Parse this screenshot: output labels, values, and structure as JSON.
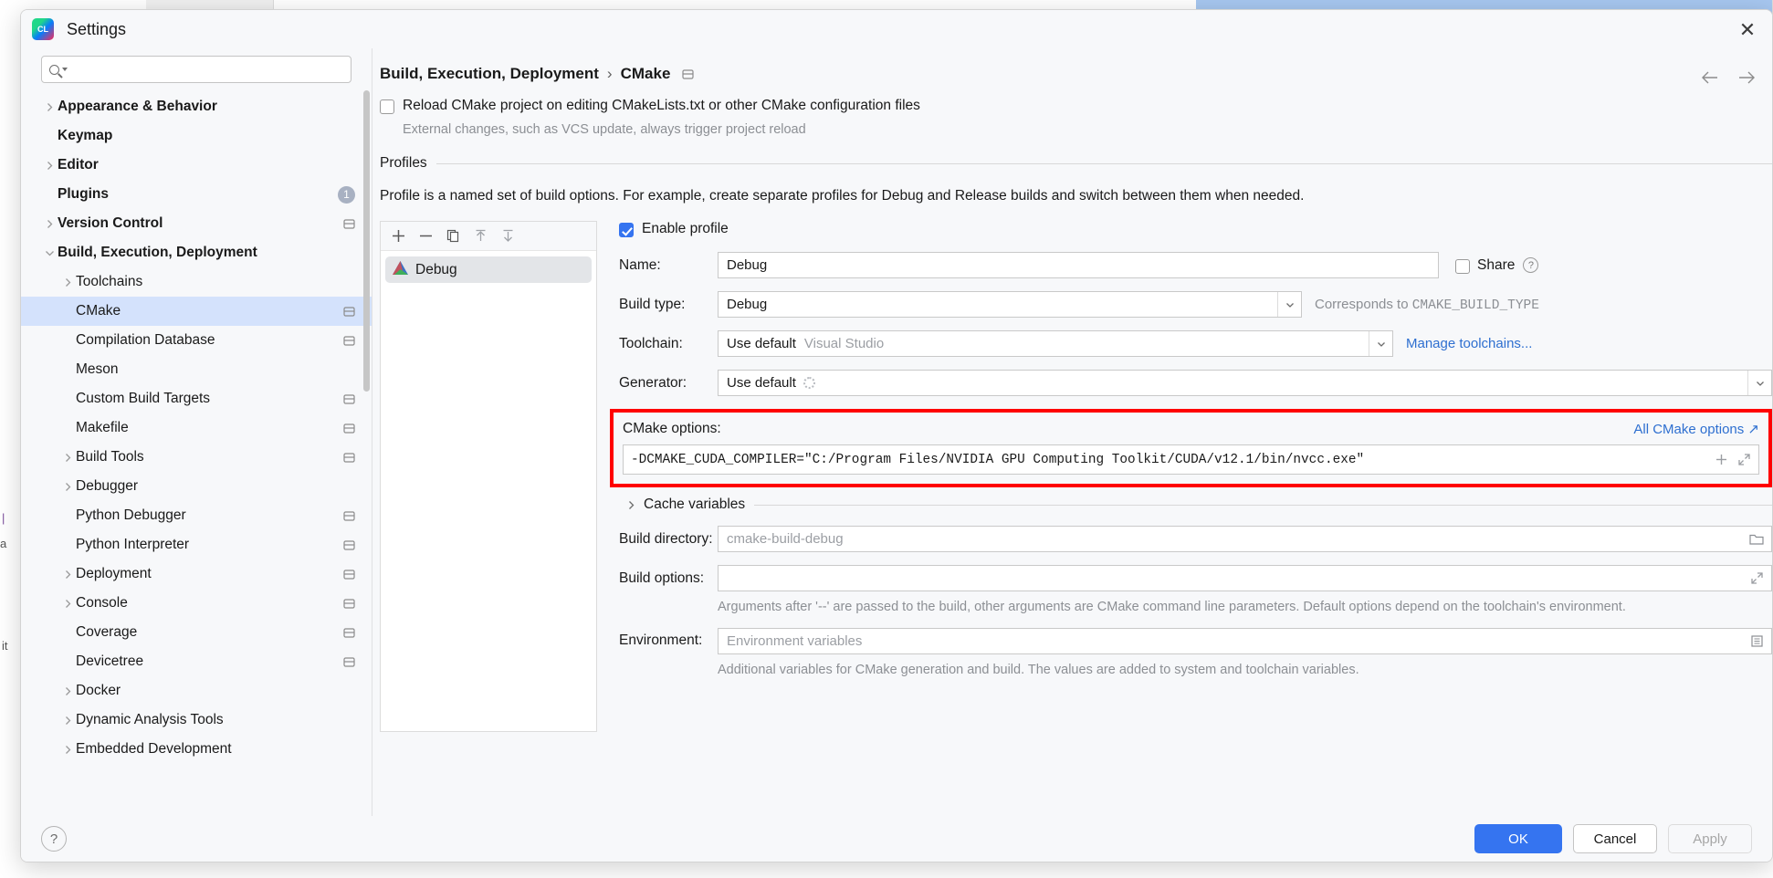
{
  "window": {
    "title": "Settings",
    "app_icon": "clion-icon",
    "close_icon": "close-icon"
  },
  "search": {
    "value": "",
    "placeholder": "",
    "icon": "search-icon"
  },
  "sidebar": {
    "items": [
      {
        "label": "Appearance & Behavior",
        "level": 0,
        "twisty": "chevron-right",
        "selected": false
      },
      {
        "label": "Keymap",
        "level": 0,
        "twisty": "none",
        "selected": false
      },
      {
        "label": "Editor",
        "level": 0,
        "twisty": "chevron-right",
        "selected": false
      },
      {
        "label": "Plugins",
        "level": 0,
        "twisty": "none",
        "selected": false,
        "badge": "1"
      },
      {
        "label": "Version Control",
        "level": 0,
        "twisty": "chevron-right",
        "selected": false,
        "project_icon": true
      },
      {
        "label": "Build, Execution, Deployment",
        "level": 0,
        "twisty": "chevron-down",
        "selected": false
      },
      {
        "label": "Toolchains",
        "level": 1,
        "twisty": "chevron-right",
        "selected": false
      },
      {
        "label": "CMake",
        "level": 1,
        "twisty": "none",
        "selected": true,
        "project_icon": true
      },
      {
        "label": "Compilation Database",
        "level": 1,
        "twisty": "none",
        "selected": false,
        "project_icon": true
      },
      {
        "label": "Meson",
        "level": 1,
        "twisty": "none",
        "selected": false
      },
      {
        "label": "Custom Build Targets",
        "level": 1,
        "twisty": "none",
        "selected": false,
        "project_icon": true
      },
      {
        "label": "Makefile",
        "level": 1,
        "twisty": "none",
        "selected": false,
        "project_icon": true
      },
      {
        "label": "Build Tools",
        "level": 1,
        "twisty": "chevron-right",
        "selected": false,
        "project_icon": true
      },
      {
        "label": "Debugger",
        "level": 1,
        "twisty": "chevron-right",
        "selected": false
      },
      {
        "label": "Python Debugger",
        "level": 1,
        "twisty": "none",
        "selected": false,
        "project_icon": true
      },
      {
        "label": "Python Interpreter",
        "level": 1,
        "twisty": "none",
        "selected": false,
        "project_icon": true
      },
      {
        "label": "Deployment",
        "level": 1,
        "twisty": "chevron-right",
        "selected": false,
        "project_icon": true
      },
      {
        "label": "Console",
        "level": 1,
        "twisty": "chevron-right",
        "selected": false,
        "project_icon": true
      },
      {
        "label": "Coverage",
        "level": 1,
        "twisty": "none",
        "selected": false,
        "project_icon": true
      },
      {
        "label": "Devicetree",
        "level": 1,
        "twisty": "none",
        "selected": false,
        "project_icon": true
      },
      {
        "label": "Docker",
        "level": 1,
        "twisty": "chevron-right",
        "selected": false
      },
      {
        "label": "Dynamic Analysis Tools",
        "level": 1,
        "twisty": "chevron-right",
        "selected": false
      },
      {
        "label": "Embedded Development",
        "level": 1,
        "twisty": "chevron-right",
        "selected": false
      }
    ]
  },
  "breadcrumb": {
    "root": "Build, Execution, Deployment",
    "separator": "›",
    "leaf": "CMake",
    "project_icon": "project-scope-icon",
    "back_icon": "arrow-left-icon",
    "forward_icon": "arrow-right-icon"
  },
  "main": {
    "reload_checkbox": {
      "label": "Reload CMake project on editing CMakeLists.txt or other CMake configuration files",
      "checked": false
    },
    "reload_hint": "External changes, such as VCS update, always trigger project reload",
    "profiles_group_title": "Profiles",
    "profiles_description": "Profile is a named set of build options. For example, create separate profiles for Debug and Release builds and switch between them when needed.",
    "profile_toolbar": [
      {
        "name": "add-profile-button",
        "glyph": "+"
      },
      {
        "name": "remove-profile-button",
        "glyph": "−"
      },
      {
        "name": "copy-profile-button",
        "glyph": "copy-icon"
      },
      {
        "name": "move-up-button",
        "glyph": "arrow-up-icon"
      },
      {
        "name": "move-down-button",
        "glyph": "arrow-down-icon"
      }
    ],
    "profiles": [
      {
        "name": "Debug",
        "selected": true,
        "icon": "cmake-icon"
      }
    ],
    "form": {
      "enable_profile": {
        "label": "Enable profile",
        "checked": true
      },
      "name": {
        "label": "Name:",
        "value": "Debug"
      },
      "share": {
        "label": "Share",
        "checked": false,
        "help_icon": "help-icon"
      },
      "build_type": {
        "label": "Build type:",
        "value": "Debug",
        "note_prefix": "Corresponds to ",
        "note_mono": "CMAKE_BUILD_TYPE"
      },
      "toolchain": {
        "label": "Toolchain:",
        "value": "Use default",
        "value_muted": "Visual Studio",
        "link": "Manage toolchains..."
      },
      "generator": {
        "label": "Generator:",
        "value": "Use default",
        "loading": true
      },
      "cmake_options": {
        "label": "CMake options:",
        "value": "-DCMAKE_CUDA_COMPILER=\"C:/Program Files/NVIDIA GPU Computing Toolkit/CUDA/v12.1/bin/nvcc.exe\"",
        "link": "All CMake options ↗",
        "add_icon": "plus-icon",
        "expand_icon": "expand-icon",
        "highlight_color": "#ff0000"
      },
      "cache_variables": {
        "label": "Cache variables",
        "expanded": false
      },
      "build_directory": {
        "label": "Build directory:",
        "value": "",
        "placeholder": "cmake-build-debug",
        "browse_icon": "folder-icon"
      },
      "build_options": {
        "label": "Build options:",
        "value": "",
        "expand_icon": "expand-icon"
      },
      "build_options_hint": "Arguments after '--' are passed to the build, other arguments are CMake command line parameters. Default options depend on the toolchain's environment.",
      "environment": {
        "label": "Environment:",
        "value": "",
        "placeholder": "Environment variables",
        "edit_icon": "list-icon"
      },
      "environment_hint": "Additional variables for CMake generation and build. The values are added to system and toolchain variables."
    }
  },
  "footer": {
    "help": "?",
    "ok": "OK",
    "cancel": "Cancel",
    "apply": "Apply",
    "ok_color": "#3574f0"
  }
}
